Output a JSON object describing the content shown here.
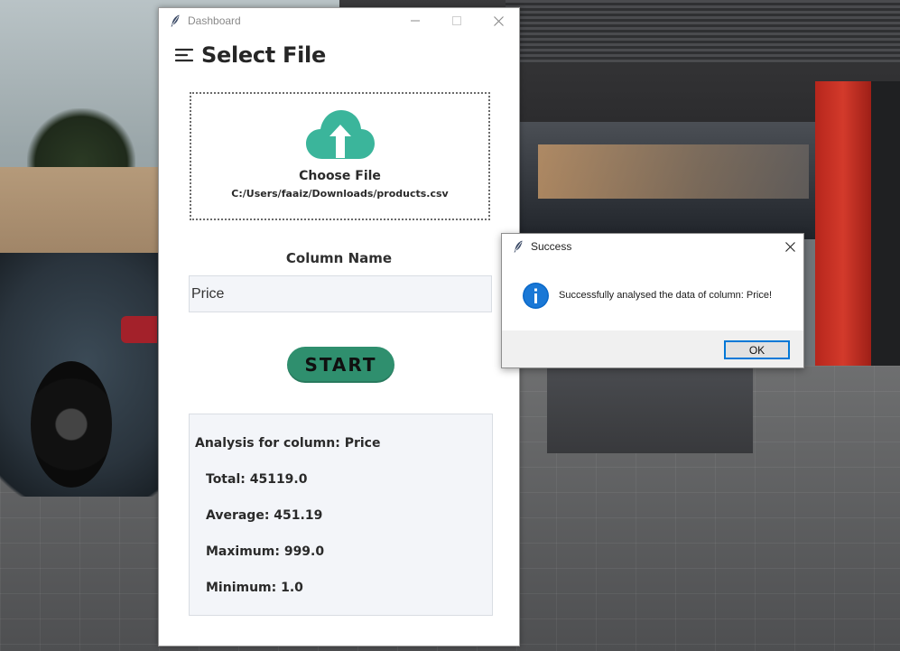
{
  "main_window": {
    "title": "Dashboard",
    "page_title": "Select File",
    "upload": {
      "label": "Choose File",
      "file_path": "C:/Users/faaiz/Downloads/products.csv"
    },
    "column": {
      "label": "Column Name",
      "value": "Price"
    },
    "start_label": "START",
    "analysis": {
      "title": "Analysis for column: Price",
      "rows": [
        "Total: 45119.0",
        "Average: 451.19",
        "Maximum: 999.0",
        "Minimum: 1.0"
      ]
    }
  },
  "dialog": {
    "title": "Success",
    "message": "Successfully analysed the data of column: Price!",
    "ok_label": "OK"
  },
  "colors": {
    "accent_green": "#2f8f6e",
    "cloud_teal": "#3bb59b",
    "info_blue": "#0a68c8",
    "focus_blue": "#0078d7"
  },
  "icons": [
    "feather-icon",
    "minimize-icon",
    "maximize-icon",
    "close-icon",
    "menu-icon",
    "cloud-upload-icon",
    "info-icon"
  ]
}
